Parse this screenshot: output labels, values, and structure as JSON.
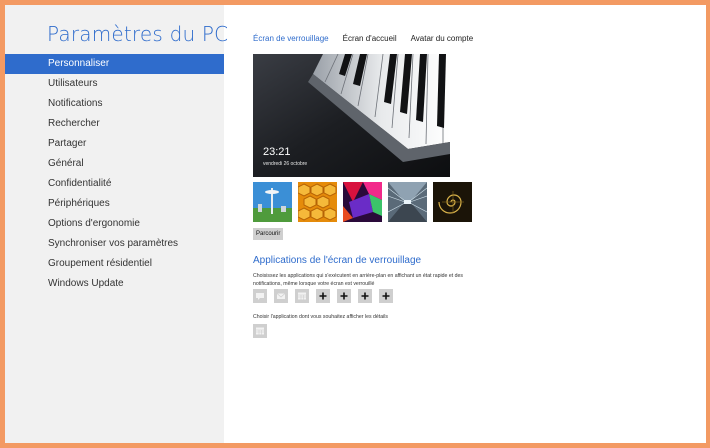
{
  "sidebar": {
    "title": "Paramètres du PC",
    "items": [
      {
        "label": "Personnaliser",
        "name": "sidebar-item-personnaliser",
        "selected": true
      },
      {
        "label": "Utilisateurs",
        "name": "sidebar-item-utilisateurs"
      },
      {
        "label": "Notifications",
        "name": "sidebar-item-notifications"
      },
      {
        "label": "Rechercher",
        "name": "sidebar-item-rechercher"
      },
      {
        "label": "Partager",
        "name": "sidebar-item-partager"
      },
      {
        "label": "Général",
        "name": "sidebar-item-general"
      },
      {
        "label": "Confidentialité",
        "name": "sidebar-item-confidentialite"
      },
      {
        "label": "Périphériques",
        "name": "sidebar-item-peripheriques"
      },
      {
        "label": "Options d'ergonomie",
        "name": "sidebar-item-options-ergonomie"
      },
      {
        "label": "Synchroniser vos paramètres",
        "name": "sidebar-item-synchroniser"
      },
      {
        "label": "Groupement résidentiel",
        "name": "sidebar-item-groupement-residentiel"
      },
      {
        "label": "Windows Update",
        "name": "sidebar-item-windows-update"
      }
    ]
  },
  "main": {
    "tabs": [
      {
        "label": "Écran de verrouillage",
        "active": true
      },
      {
        "label": "Écran d'accueil"
      },
      {
        "label": "Avatar du compte"
      }
    ],
    "preview": {
      "time": "23:21",
      "date": "vendredi 26 octobre"
    },
    "browse_label": "Parcourir",
    "apps_heading": "Applications de l'écran de verrouillage",
    "apps_description": "Choisissez les applications qui s'exécutent en arrière-plan en affichant un état rapide et des notifications, même lorsque votre écran est verrouillé",
    "detail_description": "Choisir l'application dont vous souhaitez afficher les détails",
    "app_slots": [
      "message-icon",
      "mail-icon",
      "calendar-icon",
      "add-icon",
      "add-icon",
      "add-icon",
      "add-icon"
    ],
    "detail_slot_icon": "calendar-icon"
  },
  "colors": {
    "accent": "#2f6ccc",
    "border": "#f39a63",
    "sidebar_bg": "#f1f1f1"
  }
}
